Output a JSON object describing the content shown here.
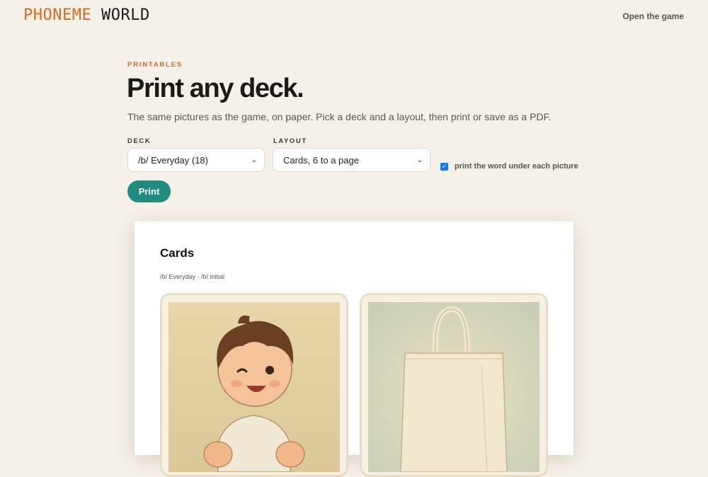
{
  "header": {
    "logo_part1": "PHONEME",
    "logo_part2": "WORLD",
    "open_game": "Open the game"
  },
  "intro": {
    "eyebrow": "PRINTABLES",
    "title": "Print any deck.",
    "subtitle": "The same pictures as the game, on paper. Pick a deck and a layout, then print or save as a PDF."
  },
  "form": {
    "deck_label": "DECK",
    "deck_value": "/b/ Everyday (18)",
    "layout_label": "LAYOUT",
    "layout_value": "Cards, 6 to a page",
    "checkbox_label": "print the word under each picture",
    "checkbox_checked": true,
    "print_button": "Print"
  },
  "preview": {
    "title": "Cards",
    "meta": "/b/ Everyday · /b/ initial",
    "cards": [
      {
        "icon": "baby-picture"
      },
      {
        "icon": "bag-picture"
      }
    ]
  },
  "colors": {
    "background": "#f6f1e8",
    "accent_orange": "#d96a22",
    "print_button": "#1f8c7e",
    "checkbox": "#1a73e8"
  }
}
